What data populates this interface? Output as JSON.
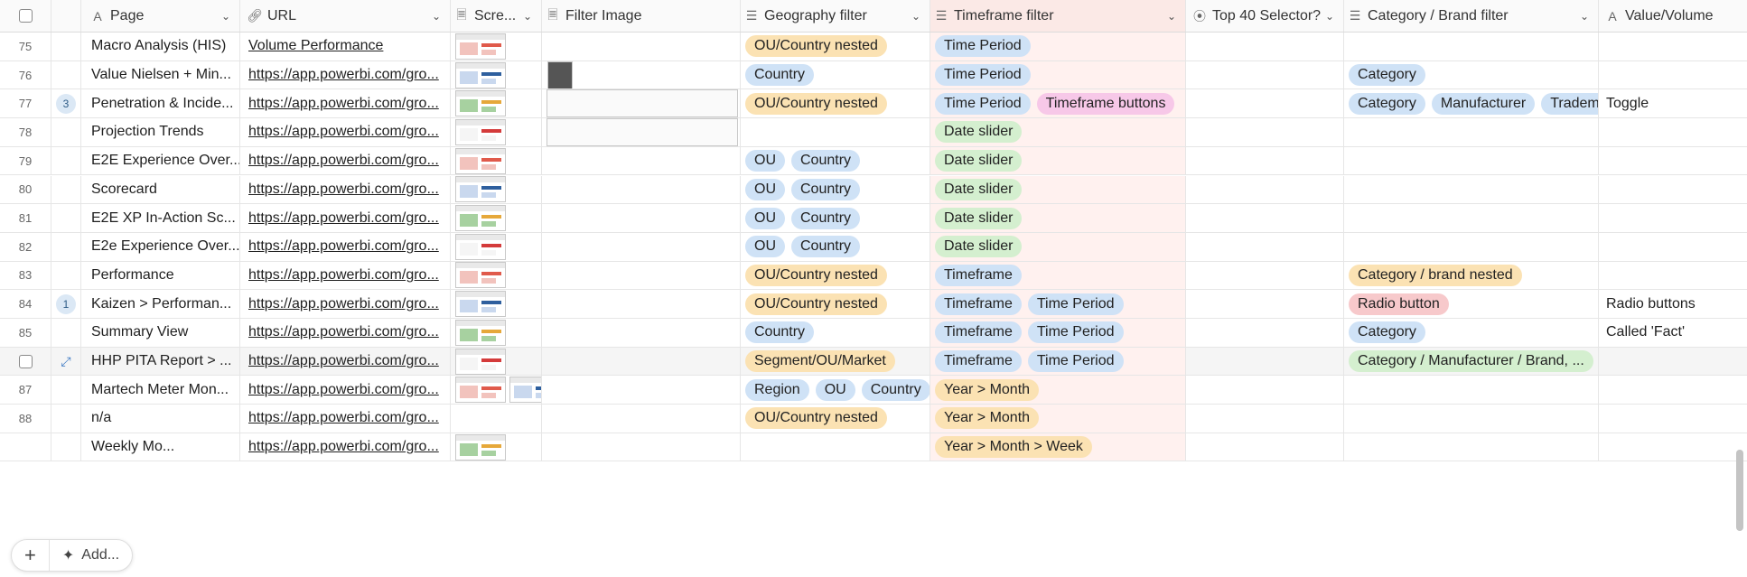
{
  "columns": [
    {
      "key": "page",
      "label": "Page",
      "icon": "text-type-icon"
    },
    {
      "key": "url",
      "label": "URL",
      "icon": "link-icon"
    },
    {
      "key": "scr",
      "label": "Scre...",
      "icon": "file-icon"
    },
    {
      "key": "fimg",
      "label": "Filter Image",
      "icon": "file-icon"
    },
    {
      "key": "geo",
      "label": "Geography filter",
      "icon": "multi-select-icon"
    },
    {
      "key": "time",
      "label": "Timeframe filter",
      "icon": "multi-select-icon"
    },
    {
      "key": "top",
      "label": "Top 40 Selector?",
      "icon": "select-icon"
    },
    {
      "key": "cat",
      "label": "Category / Brand filter",
      "icon": "multi-select-icon"
    },
    {
      "key": "val",
      "label": "Value/Volume",
      "icon": "text-type-icon"
    }
  ],
  "rows": [
    {
      "num": "75",
      "count": "",
      "page": "Macro Analysis (HIS)",
      "url": "Volume Performance",
      "thumbs": 1,
      "filter_image": "",
      "geo": [
        [
          "OU/Country nested",
          "orange"
        ]
      ],
      "time": [
        [
          "Time Period",
          "blue"
        ]
      ],
      "top": "",
      "cat": [],
      "val": ""
    },
    {
      "num": "76",
      "count": "",
      "page": "Value Nielsen + Min...",
      "url": "https://app.powerbi.com/gro...",
      "thumbs": 1,
      "filter_image": "small",
      "geo": [
        [
          "Country",
          "blue"
        ]
      ],
      "time": [
        [
          "Time Period",
          "blue"
        ]
      ],
      "top": "",
      "cat": [
        [
          "Category",
          "blue"
        ]
      ],
      "val": ""
    },
    {
      "num": "77",
      "count": "3",
      "page": "Penetration & Incide...",
      "url": "https://app.powerbi.com/gro...",
      "thumbs": 1,
      "filter_image": "wide",
      "geo": [
        [
          "OU/Country nested",
          "orange"
        ]
      ],
      "time": [
        [
          "Time Period",
          "blue"
        ],
        [
          "Timeframe buttons",
          "pink"
        ]
      ],
      "top": "",
      "cat": [
        [
          "Category",
          "blue"
        ],
        [
          "Manufacturer",
          "blue"
        ],
        [
          "Tradema",
          "blue"
        ]
      ],
      "val": "Toggle"
    },
    {
      "num": "78",
      "count": "",
      "page": "Projection Trends",
      "url": "https://app.powerbi.com/gro...",
      "thumbs": 1,
      "filter_image": "wide",
      "geo": [],
      "time": [
        [
          "Date slider",
          "green"
        ]
      ],
      "top": "",
      "cat": [],
      "val": ""
    },
    {
      "num": "79",
      "count": "",
      "page": "E2E Experience Over...",
      "url": "https://app.powerbi.com/gro...",
      "thumbs": 1,
      "filter_image": "",
      "geo": [
        [
          "OU",
          "blue"
        ],
        [
          "Country",
          "blue"
        ]
      ],
      "time": [
        [
          "Date slider",
          "green"
        ]
      ],
      "top": "",
      "cat": [],
      "val": ""
    },
    {
      "num": "80",
      "count": "",
      "page": "Scorecard",
      "url": "https://app.powerbi.com/gro...",
      "thumbs": 1,
      "filter_image": "",
      "geo": [
        [
          "OU",
          "blue"
        ],
        [
          "Country",
          "blue"
        ]
      ],
      "time": [
        [
          "Date slider",
          "green"
        ]
      ],
      "top": "",
      "cat": [],
      "val": ""
    },
    {
      "num": "81",
      "count": "",
      "page": "E2E XP In-Action Sc...",
      "url": "https://app.powerbi.com/gro...",
      "thumbs": 1,
      "filter_image": "",
      "geo": [
        [
          "OU",
          "blue"
        ],
        [
          "Country",
          "blue"
        ]
      ],
      "time": [
        [
          "Date slider",
          "green"
        ]
      ],
      "top": "",
      "cat": [],
      "val": ""
    },
    {
      "num": "82",
      "count": "",
      "page": "E2e Experience Over...",
      "url": "https://app.powerbi.com/gro...",
      "thumbs": 1,
      "filter_image": "",
      "geo": [
        [
          "OU",
          "blue"
        ],
        [
          "Country",
          "blue"
        ]
      ],
      "time": [
        [
          "Date slider",
          "green"
        ]
      ],
      "top": "",
      "cat": [],
      "val": ""
    },
    {
      "num": "83",
      "count": "",
      "page": "Performance",
      "url": "https://app.powerbi.com/gro...",
      "thumbs": 1,
      "filter_image": "",
      "geo": [
        [
          "OU/Country nested",
          "orange"
        ]
      ],
      "time": [
        [
          "Timeframe",
          "blue"
        ]
      ],
      "top": "",
      "cat": [
        [
          "Category / brand nested",
          "orange"
        ]
      ],
      "val": ""
    },
    {
      "num": "84",
      "count": "1",
      "page": "Kaizen > Performan...",
      "url": "https://app.powerbi.com/gro...",
      "thumbs": 1,
      "filter_image": "",
      "geo": [
        [
          "OU/Country nested",
          "orange"
        ]
      ],
      "time": [
        [
          "Timeframe",
          "blue"
        ],
        [
          "Time Period",
          "blue"
        ]
      ],
      "top": "",
      "cat": [
        [
          "Radio button",
          "red"
        ]
      ],
      "val": "Radio buttons"
    },
    {
      "num": "85",
      "count": "",
      "page": "Summary View",
      "url": "https://app.powerbi.com/gro...",
      "thumbs": 1,
      "filter_image": "",
      "geo": [
        [
          "Country",
          "blue"
        ]
      ],
      "time": [
        [
          "Timeframe",
          "blue"
        ],
        [
          "Time Period",
          "blue"
        ]
      ],
      "top": "",
      "cat": [
        [
          "Category",
          "blue"
        ]
      ],
      "val": "Called 'Fact'"
    },
    {
      "num": "",
      "count": "",
      "page": "HHP PITA Report > ...",
      "url": "https://app.powerbi.com/gro...",
      "thumbs": 1,
      "filter_image": "",
      "geo": [
        [
          "Segment/OU/Market",
          "orange"
        ]
      ],
      "time": [
        [
          "Timeframe",
          "blue"
        ],
        [
          "Time Period",
          "blue"
        ]
      ],
      "top": "",
      "cat": [
        [
          "Category / Manufacturer / Brand, ...",
          "green"
        ]
      ],
      "val": "",
      "hovered": true
    },
    {
      "num": "87",
      "count": "",
      "page": "Martech Meter Mon...",
      "url": "https://app.powerbi.com/gro...",
      "thumbs": 2,
      "filter_image": "",
      "geo": [
        [
          "Region",
          "blue"
        ],
        [
          "OU",
          "blue"
        ],
        [
          "Country",
          "blue"
        ]
      ],
      "time": [
        [
          "Year > Month",
          "orange"
        ]
      ],
      "top": "",
      "cat": [],
      "val": ""
    },
    {
      "num": "88",
      "count": "",
      "page": "n/a",
      "url": "https://app.powerbi.com/gro...",
      "thumbs": 0,
      "filter_image": "",
      "geo": [
        [
          "OU/Country nested",
          "orange"
        ]
      ],
      "time": [
        [
          "Year > Month",
          "orange"
        ]
      ],
      "top": "",
      "cat": [],
      "val": ""
    },
    {
      "num": "",
      "count": "",
      "page": "Weekly Mo...",
      "url": "https://app.powerbi.com/gro...",
      "thumbs": 1,
      "filter_image": "",
      "geo": [],
      "time": [
        [
          "Year > Month > Week",
          "orange"
        ]
      ],
      "top": "",
      "cat": [],
      "val": ""
    }
  ],
  "footer": {
    "add_label": "+",
    "ai_label": "Add..."
  },
  "colors": {
    "blue": "#cfe2f6",
    "orange": "#fbe2b3",
    "green": "#d4efcf",
    "pink": "#f7c8e8",
    "red": "#f7c9cb",
    "timeframe_bg": "#fff1ef"
  }
}
